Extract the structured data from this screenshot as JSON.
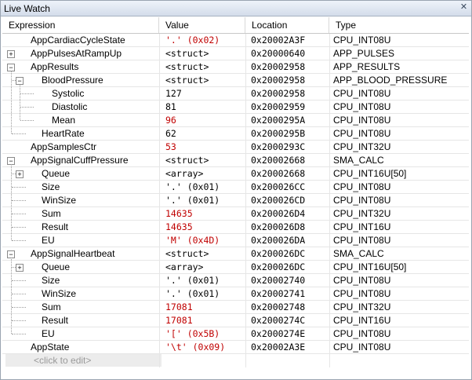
{
  "window": {
    "title": "Live Watch"
  },
  "columns": [
    "Expression",
    "Value",
    "Location",
    "Type"
  ],
  "rows": [
    {
      "name": "AppCardiacCycleState",
      "value": "'.' (0x02)",
      "red": true,
      "loc": "0x20002A3F",
      "type": "CPU_INT08U",
      "level": 0,
      "expand": ""
    },
    {
      "name": "AppPulsesAtRampUp",
      "value": "<struct>",
      "red": false,
      "loc": "0x20000640",
      "type": "APP_PULSES",
      "level": 0,
      "expand": "+"
    },
    {
      "name": "AppResults",
      "value": "<struct>",
      "red": false,
      "loc": "0x20002958",
      "type": "APP_RESULTS",
      "level": 0,
      "expand": "-"
    },
    {
      "name": "BloodPressure",
      "value": "<struct>",
      "red": false,
      "loc": "0x20002958",
      "type": "APP_BLOOD_PRESSURE",
      "level": 1,
      "expand": "-"
    },
    {
      "name": "Systolic",
      "value": "127",
      "red": false,
      "loc": "0x20002958",
      "type": "CPU_INT08U",
      "level": 2,
      "expand": ""
    },
    {
      "name": "Diastolic",
      "value": "81",
      "red": false,
      "loc": "0x20002959",
      "type": "CPU_INT08U",
      "level": 2,
      "expand": ""
    },
    {
      "name": "Mean",
      "value": "96",
      "red": true,
      "loc": "0x2000295A",
      "type": "CPU_INT08U",
      "level": 2,
      "expand": ""
    },
    {
      "name": "HeartRate",
      "value": "62",
      "red": false,
      "loc": "0x2000295B",
      "type": "CPU_INT08U",
      "level": 1,
      "expand": ""
    },
    {
      "name": "AppSamplesCtr",
      "value": "53",
      "red": true,
      "loc": "0x2000293C",
      "type": "CPU_INT32U",
      "level": 0,
      "expand": ""
    },
    {
      "name": "AppSignalCuffPressure",
      "value": "<struct>",
      "red": false,
      "loc": "0x20002668",
      "type": "SMA_CALC",
      "level": 0,
      "expand": "-"
    },
    {
      "name": "Queue",
      "value": "<array>",
      "red": false,
      "loc": "0x20002668",
      "type": "CPU_INT16U[50]",
      "level": 1,
      "expand": "+"
    },
    {
      "name": "Size",
      "value": "'.' (0x01)",
      "red": false,
      "loc": "0x200026CC",
      "type": "CPU_INT08U",
      "level": 1,
      "expand": ""
    },
    {
      "name": "WinSize",
      "value": "'.' (0x01)",
      "red": false,
      "loc": "0x200026CD",
      "type": "CPU_INT08U",
      "level": 1,
      "expand": ""
    },
    {
      "name": "Sum",
      "value": "14635",
      "red": true,
      "loc": "0x200026D4",
      "type": "CPU_INT32U",
      "level": 1,
      "expand": ""
    },
    {
      "name": "Result",
      "value": "14635",
      "red": true,
      "loc": "0x200026D8",
      "type": "CPU_INT16U",
      "level": 1,
      "expand": ""
    },
    {
      "name": "EU",
      "value": "'M' (0x4D)",
      "red": true,
      "loc": "0x200026DA",
      "type": "CPU_INT08U",
      "level": 1,
      "expand": ""
    },
    {
      "name": "AppSignalHeartbeat",
      "value": "<struct>",
      "red": false,
      "loc": "0x200026DC",
      "type": "SMA_CALC",
      "level": 0,
      "expand": "-"
    },
    {
      "name": "Queue",
      "value": "<array>",
      "red": false,
      "loc": "0x200026DC",
      "type": "CPU_INT16U[50]",
      "level": 1,
      "expand": "+"
    },
    {
      "name": "Size",
      "value": "'.' (0x01)",
      "red": false,
      "loc": "0x20002740",
      "type": "CPU_INT08U",
      "level": 1,
      "expand": ""
    },
    {
      "name": "WinSize",
      "value": "'.' (0x01)",
      "red": false,
      "loc": "0x20002741",
      "type": "CPU_INT08U",
      "level": 1,
      "expand": ""
    },
    {
      "name": "Sum",
      "value": "17081",
      "red": true,
      "loc": "0x20002748",
      "type": "CPU_INT32U",
      "level": 1,
      "expand": ""
    },
    {
      "name": "Result",
      "value": "17081",
      "red": true,
      "loc": "0x2000274C",
      "type": "CPU_INT16U",
      "level": 1,
      "expand": ""
    },
    {
      "name": "EU",
      "value": "'[' (0x5B)",
      "red": true,
      "loc": "0x2000274E",
      "type": "CPU_INT08U",
      "level": 1,
      "expand": ""
    },
    {
      "name": "AppState",
      "value": "'\\t' (0x09)",
      "red": true,
      "loc": "0x20002A3E",
      "type": "CPU_INT08U",
      "level": 0,
      "expand": ""
    }
  ],
  "click_to_edit": "<click to edit>",
  "colors": {
    "changed_value": "#c00000"
  },
  "icons": {
    "close": "close-icon",
    "expand": "expand-icon",
    "collapse": "collapse-icon"
  }
}
